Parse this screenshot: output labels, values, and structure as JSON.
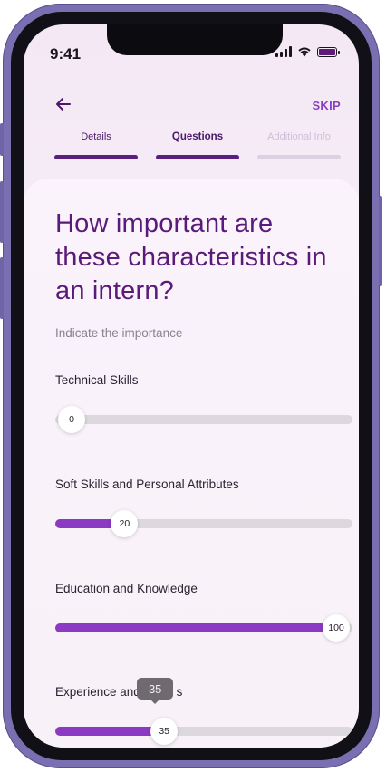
{
  "status_bar": {
    "time": "9:41"
  },
  "header": {
    "skip_label": "SKIP"
  },
  "steps": [
    {
      "label": "Details",
      "state": "done"
    },
    {
      "label": "Questions",
      "state": "active"
    },
    {
      "label": "Additional Info",
      "state": "pending"
    }
  ],
  "question": {
    "title": "How important are these characteristics in an intern?",
    "hint": "Indicate the importance"
  },
  "sliders": [
    {
      "label": "Technical Skills",
      "value": 0,
      "max": 100
    },
    {
      "label": "Soft Skills and Personal Attributes",
      "value": 20,
      "max": 100
    },
    {
      "label": "Education and Knowledge",
      "value": 100,
      "max": 100
    },
    {
      "label": "Experience and Projects",
      "label_visible_start": "Experience and P",
      "label_visible_end": "s",
      "value": 35,
      "max": 100,
      "tooltip": "35"
    }
  ],
  "colors": {
    "accent": "#8b3ac4",
    "title": "#5a1a79",
    "step_active": "#581f7e"
  }
}
